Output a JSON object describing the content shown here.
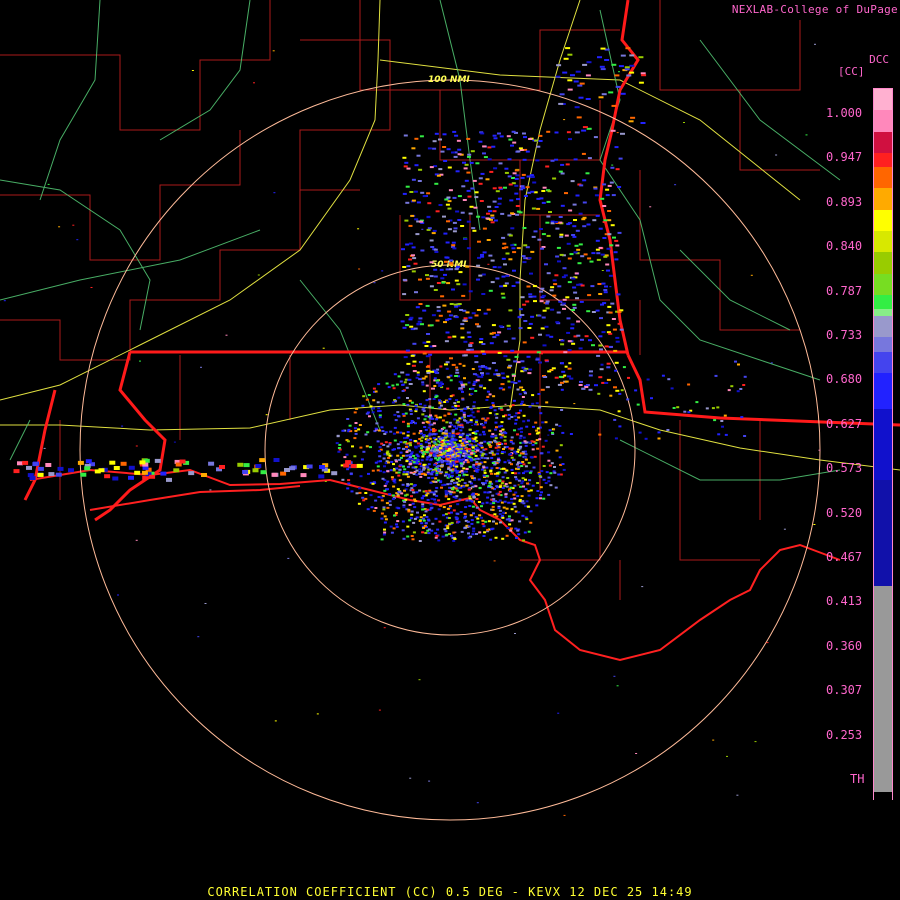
{
  "credit": "NEXLAB-College of DuPage",
  "logo_text": "DCC",
  "units": "[CC]",
  "footer": "CORRELATION COEFFICIENT (CC) 0.5 DEG - KEVX 12 DEC 25 14:49",
  "range_rings": [
    "100 NMI",
    "50 NMI"
  ],
  "scale": {
    "labels": [
      "1.000",
      "0.947",
      "0.893",
      "0.840",
      "0.787",
      "0.733",
      "0.680",
      "0.627",
      "0.573",
      "0.520",
      "0.467",
      "0.413",
      "0.360",
      "0.307",
      "0.253",
      "TH"
    ],
    "colors": [
      {
        "stop": 0.0,
        "color": "#ffb0d0"
      },
      {
        "stop": 0.03,
        "color": "#ff88bb"
      },
      {
        "stop": 0.06,
        "color": "#d01040"
      },
      {
        "stop": 0.09,
        "color": "#ff2020"
      },
      {
        "stop": 0.11,
        "color": "#ff6600"
      },
      {
        "stop": 0.14,
        "color": "#ffaa00"
      },
      {
        "stop": 0.17,
        "color": "#ffff00"
      },
      {
        "stop": 0.2,
        "color": "#d8e800"
      },
      {
        "stop": 0.23,
        "color": "#99cc00"
      },
      {
        "stop": 0.26,
        "color": "#77dd22"
      },
      {
        "stop": 0.29,
        "color": "#33ee44"
      },
      {
        "stop": 0.31,
        "color": "#88ee88"
      },
      {
        "stop": 0.32,
        "color": "#9999cc"
      },
      {
        "stop": 0.35,
        "color": "#7777dd"
      },
      {
        "stop": 0.37,
        "color": "#4444ee"
      },
      {
        "stop": 0.4,
        "color": "#2222ff"
      },
      {
        "stop": 0.45,
        "color": "#1111cc"
      },
      {
        "stop": 0.55,
        "color": "#1111aa"
      },
      {
        "stop": 0.7,
        "color": "#151599"
      },
      {
        "stop": 0.7,
        "color": "#999999"
      },
      {
        "stop": 0.99,
        "color": "#999999"
      },
      {
        "stop": 0.99,
        "color": "#000000"
      }
    ]
  }
}
